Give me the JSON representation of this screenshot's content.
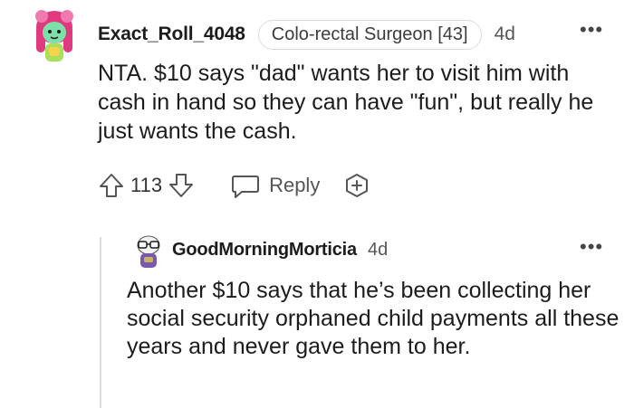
{
  "comment": {
    "author": "Exact_Roll_4048",
    "flair": "Colo-rectal Surgeon [43]",
    "age": "4d",
    "more_menu": "•••",
    "avatar_icon": "snoo-avatar-pink-hair-icon",
    "body": "NTA. $10 says \"dad\" wants her to visit him with cash in hand so they can have \"fun\", but really he just wants the cash.",
    "score": "113",
    "reply_label": "Reply",
    "upvote_icon": "upvote-arrow-icon",
    "downvote_icon": "downvote-arrow-icon",
    "reply_icon": "speech-bubble-icon",
    "award_icon": "award-plus-icon"
  },
  "reply": {
    "author": "GoodMorningMorticia",
    "age": "4d",
    "more_menu": "•••",
    "avatar_icon": "snoo-avatar-glasses-icon",
    "body": "Another $10 says that he’s been collecting her social security orphaned child payments all these years and never gave them to her."
  },
  "colors": {
    "text": "#1c1c1c",
    "meta": "#555555",
    "flair_border": "#d9dcde",
    "thread_line": "#dadcde",
    "avatar1_hair": "#e0397f",
    "avatar1_skin": "#7ee0a8",
    "avatar2_body": "#7a5aa8"
  }
}
